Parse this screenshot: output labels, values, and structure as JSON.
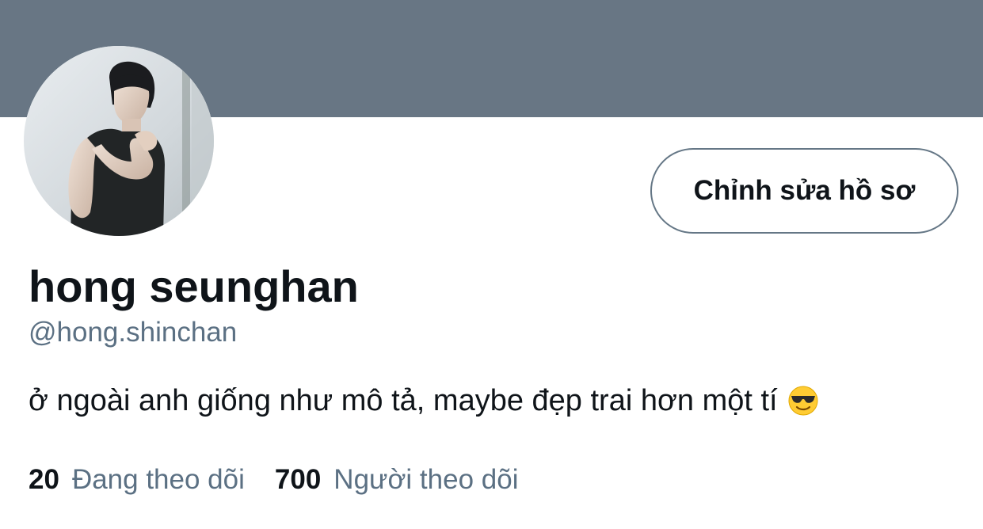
{
  "colors": {
    "banner": "#687684",
    "text_primary": "#0f1419",
    "text_secondary": "#5b7083",
    "button_border": "#657786"
  },
  "profile": {
    "edit_button_label": "Chỉnh sửa hồ sơ",
    "display_name": "hong seunghan",
    "handle": "@hong.shinchan",
    "bio": "ở ngoài anh giống như mô tả, maybe đẹp trai hơn một tí",
    "bio_emoji_icon": "sunglasses-smiling-face-icon"
  },
  "stats": {
    "following_count": "20",
    "following_label": "Đang theo dõi",
    "followers_count": "700",
    "followers_label": "Người theo dõi"
  }
}
